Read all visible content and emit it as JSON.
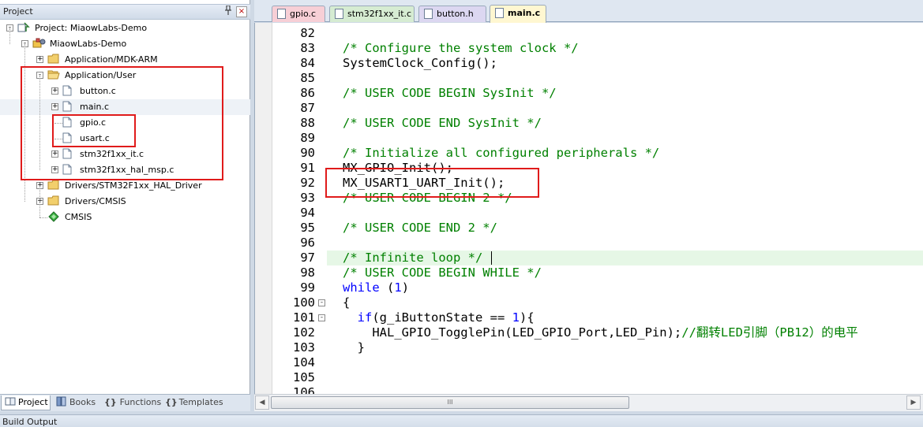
{
  "panel": {
    "title": "Project",
    "pin_glyph": "█",
    "close_glyph": "×"
  },
  "tree": [
    {
      "label": "Project: MiaowLabs-Demo",
      "icon": "project-icon",
      "expander": "-"
    },
    {
      "label": "MiaowLabs-Demo",
      "icon": "target-icon",
      "expander": "-"
    },
    {
      "label": "Application/MDK-ARM",
      "icon": "folder-icon",
      "expander": "+"
    },
    {
      "label": "Application/User",
      "icon": "folder-open-icon",
      "expander": "-"
    },
    {
      "label": "button.c",
      "icon": "file-icon",
      "expander": "+"
    },
    {
      "label": "main.c",
      "icon": "file-icon",
      "expander": "+"
    },
    {
      "label": "gpio.c",
      "icon": "file-icon",
      "expander": ""
    },
    {
      "label": "usart.c",
      "icon": "file-icon",
      "expander": ""
    },
    {
      "label": "stm32f1xx_it.c",
      "icon": "file-icon",
      "expander": "+"
    },
    {
      "label": "stm32f1xx_hal_msp.c",
      "icon": "file-icon",
      "expander": "+"
    },
    {
      "label": "Drivers/STM32F1xx_HAL_Driver",
      "icon": "folder-icon",
      "expander": "+"
    },
    {
      "label": "Drivers/CMSIS",
      "icon": "folder-icon",
      "expander": "+"
    },
    {
      "label": "CMSIS",
      "icon": "gem-icon",
      "expander": ""
    }
  ],
  "bottom_tabs": [
    {
      "label": "Project",
      "icon": "project-tab-icon",
      "active": true
    },
    {
      "label": "Books",
      "icon": "books-icon",
      "active": false
    },
    {
      "label": "Functions",
      "icon": "braces-icon",
      "active": false
    },
    {
      "label": "Templates",
      "icon": "templates-icon",
      "active": false
    }
  ],
  "braces_glyph": "{}",
  "templates_glyph": "{}",
  "editor_tabs": [
    {
      "label": "gpio.c",
      "color": "#f7cfd6",
      "active": false
    },
    {
      "label": "stm32f1xx_it.c",
      "color": "#d6ecd2",
      "active": false
    },
    {
      "label": "button.h",
      "color": "#dcd7f1",
      "active": false
    },
    {
      "label": "main.c",
      "color": "#fff7d1",
      "active": true
    }
  ],
  "code_lines": [
    {
      "n": "82",
      "t": ""
    },
    {
      "n": "83",
      "t": "/* Configure the system clock */",
      "c": "cmt"
    },
    {
      "n": "84",
      "t": "SystemClock_Config();"
    },
    {
      "n": "85",
      "t": ""
    },
    {
      "n": "86",
      "t": "/* USER CODE BEGIN SysInit */",
      "c": "cmt"
    },
    {
      "n": "87",
      "t": ""
    },
    {
      "n": "88",
      "t": "/* USER CODE END SysInit */",
      "c": "cmt"
    },
    {
      "n": "89",
      "t": ""
    },
    {
      "n": "90",
      "t": "/* Initialize all configured peripherals */",
      "c": "cmt"
    },
    {
      "n": "91",
      "t": "MX_GPIO_Init();"
    },
    {
      "n": "92",
      "t": "MX_USART1_UART_Init();"
    },
    {
      "n": "93",
      "t": "/* USER CODE BEGIN 2 */",
      "c": "cmt"
    },
    {
      "n": "94",
      "t": ""
    },
    {
      "n": "95",
      "t": "/* USER CODE END 2 */",
      "c": "cmt"
    },
    {
      "n": "96",
      "t": ""
    },
    {
      "n": "97",
      "t": "/* Infinite loop */",
      "c": "cmt",
      "current": true
    },
    {
      "n": "98",
      "t": "/* USER CODE BEGIN WHILE */",
      "c": "cmt"
    },
    {
      "n": "99",
      "t": "while (1)"
    },
    {
      "n": "100",
      "t": "{",
      "fold": "-"
    },
    {
      "n": "101",
      "t": "  if(g_iButtonState == 1){",
      "fold": "-"
    },
    {
      "n": "102",
      "t": "    HAL_GPIO_TogglePin(LED_GPIO_Port,LED_Pin);//翻转LED引脚（PB12）的电平"
    },
    {
      "n": "103",
      "t": "  }"
    },
    {
      "n": "104",
      "t": ""
    },
    {
      "n": "105",
      "t": ""
    },
    {
      "n": "106",
      "t": ""
    }
  ],
  "build_output": {
    "label": "Build Output"
  },
  "scrollbar": {
    "left_arrow": "◀",
    "right_arrow": "▶",
    "grip": "III"
  },
  "colors": {
    "comment": "#008000",
    "keyword": "#0000ff",
    "annotation": "#e01b1b",
    "current_line": "#e6f7e6"
  }
}
